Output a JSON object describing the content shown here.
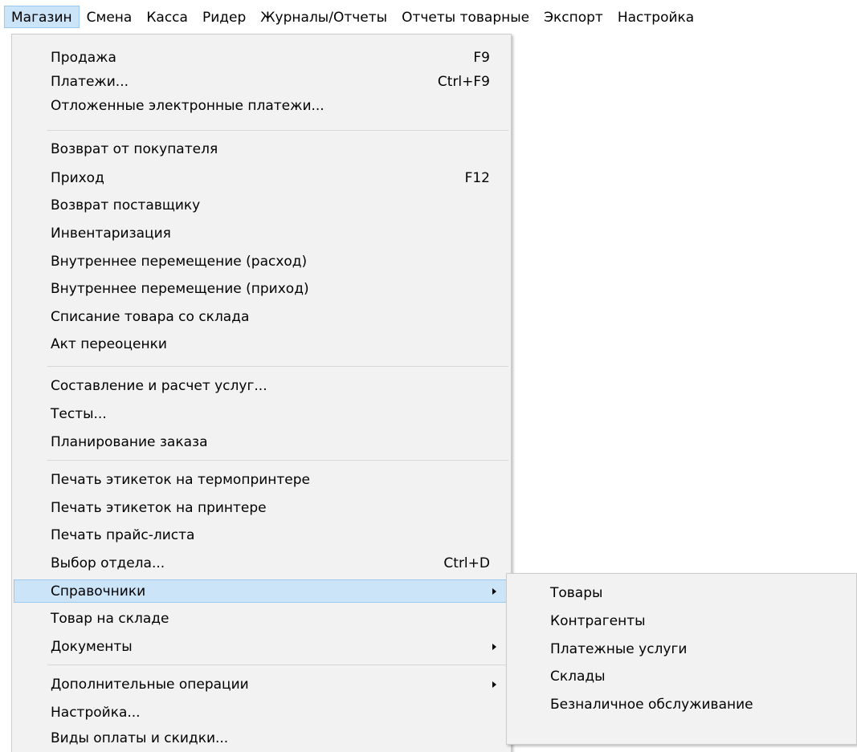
{
  "menubar": {
    "items": [
      {
        "label": "Магазин"
      },
      {
        "label": "Смена"
      },
      {
        "label": "Касса"
      },
      {
        "label": "Ридер"
      },
      {
        "label": "Журналы/Отчеты"
      },
      {
        "label": "Отчеты товарные"
      },
      {
        "label": "Экспорт"
      },
      {
        "label": "Настройка"
      }
    ]
  },
  "store_menu": {
    "items": [
      {
        "label": "Продажа",
        "shortcut": "F9"
      },
      {
        "label": "Платежи...",
        "shortcut": "Ctrl+F9"
      },
      {
        "label": "Отложенные электронные платежи..."
      },
      {
        "label": "Возврат от покупателя"
      },
      {
        "label": "Приход",
        "shortcut": "F12"
      },
      {
        "label": "Возврат поставщику"
      },
      {
        "label": "Инвентаризация"
      },
      {
        "label": "Внутреннее перемещение (расход)"
      },
      {
        "label": "Внутреннее перемещение (приход)"
      },
      {
        "label": "Списание товара со склада"
      },
      {
        "label": "Акт переоценки"
      },
      {
        "label": "Составление и расчет услуг..."
      },
      {
        "label": "Тесты..."
      },
      {
        "label": "Планирование заказа"
      },
      {
        "label": "Печать этикеток на термопринтере"
      },
      {
        "label": "Печать этикеток на принтере"
      },
      {
        "label": "Печать прайс-листа"
      },
      {
        "label": "Выбор отдела...",
        "shortcut": "Ctrl+D"
      },
      {
        "label": "Справочники"
      },
      {
        "label": "Товар на складе"
      },
      {
        "label": "Документы"
      },
      {
        "label": "Дополнительные операции"
      },
      {
        "label": "Настройка..."
      },
      {
        "label": "Виды оплаты и скидки..."
      }
    ]
  },
  "references_submenu": {
    "items": [
      {
        "label": "Товары"
      },
      {
        "label": "Контрагенты"
      },
      {
        "label": "Платежные услуги"
      },
      {
        "label": "Склады"
      },
      {
        "label": "Безналичное обслуживание"
      }
    ]
  },
  "colors": {
    "menu_background": "#f2f2f2",
    "highlight": "#cce4f7",
    "highlight_border": "#99c9ef"
  }
}
